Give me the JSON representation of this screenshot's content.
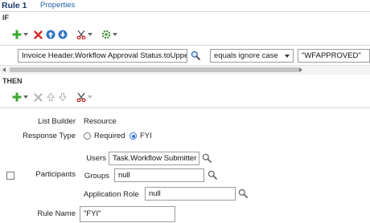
{
  "tabs": {
    "active": "Rule 1",
    "link": "Properties"
  },
  "sections": {
    "if": "IF",
    "then": "THEN"
  },
  "condition": {
    "left_value": "Invoice Header.Workflow Approval Status.toUpper",
    "operator": "equals ignore case",
    "right_value": "\"WFAPPROVED\""
  },
  "then_form": {
    "list_builder_label": "List Builder",
    "list_builder_value": "Resource",
    "response_type_label": "Response Type",
    "response_options": [
      {
        "label": "Required",
        "selected": false
      },
      {
        "label": "FYI",
        "selected": true
      }
    ],
    "participants_label": "Participants",
    "users_label": "Users",
    "users_value": "Task.Workflow Submitter",
    "groups_label": "Groups",
    "groups_value": "null",
    "app_role_label": "Application Role",
    "app_role_value": "null",
    "rule_name_label": "Rule Name",
    "rule_name_value": "\"FYI\""
  },
  "colors": {
    "add": "#3aa830",
    "delete": "#d32d2d",
    "arrow": "#2d73c8",
    "link": "#1f5fa8"
  },
  "icons": {
    "if_toolbar": [
      "add-icon",
      "delete-icon",
      "move-up-icon",
      "move-down-icon",
      "cut-icon",
      "settings-icon"
    ],
    "then_toolbar": [
      "add-icon",
      "delete-icon",
      "move-up-icon",
      "move-down-icon",
      "cut-icon"
    ],
    "search": "search-icon"
  }
}
